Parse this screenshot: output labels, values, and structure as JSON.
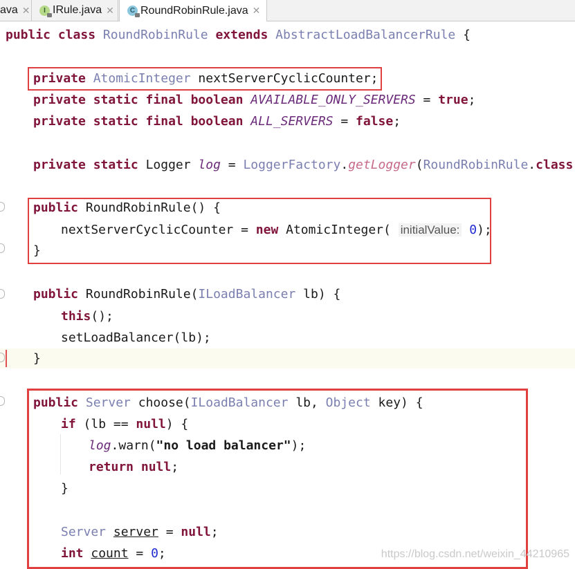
{
  "tabs": [
    {
      "label": "ava",
      "close": "✕",
      "icon": ""
    },
    {
      "label": "IRule.java",
      "close": "✕",
      "icon": "interface-icon",
      "badge": "I"
    },
    {
      "label": "RoundRobinRule.java",
      "close": "✕",
      "icon": "class-icon",
      "badge": "C",
      "active": true
    }
  ],
  "code": {
    "l1": {
      "kw1": "public class ",
      "cls": "RoundRobinRule",
      "kw2": " extends ",
      "base": "AbstractLoadBalancerRule",
      "rest": " {"
    },
    "l3": {
      "kw": "private ",
      "ty": "AtomicInteger",
      "rest": " nextServerCyclicCounter;"
    },
    "l4": {
      "kw": "private static final boolean ",
      "sf": "AVAILABLE_ONLY_SERVERS",
      "eq": " = ",
      "val": "true",
      "end": ";"
    },
    "l5": {
      "kw": "private static final boolean ",
      "sf": "ALL_SERVERS",
      "eq": " = ",
      "val": "false",
      "end": ";"
    },
    "l7": {
      "kw": "private static ",
      "t": "Logger ",
      "sf": "log",
      "eq": " = ",
      "fac": "LoggerFactory",
      "dot": ".",
      "mi": "getLogger",
      "p": "(",
      "ty": "RoundRobinRule",
      "dot2": ".",
      "kw2": "class",
      "end": ");"
    },
    "l9": {
      "kw": "public ",
      "rest": "RoundRobinRule() {"
    },
    "l10": {
      "a": "nextServerCyclicCounter = ",
      "kw": "new ",
      "b": "AtomicInteger(",
      "hint": "initialValue:",
      "num": "0",
      "end": ");"
    },
    "l11": {
      "t": "}"
    },
    "l13": {
      "kw": "public ",
      "a": "RoundRobinRule(",
      "ty": "ILoadBalancer",
      "b": " lb) {"
    },
    "l14": {
      "kw": "this",
      "end": "();"
    },
    "l15": {
      "t": "setLoadBalancer(lb);"
    },
    "l16": {
      "t": "}"
    },
    "l18": {
      "kw": "public ",
      "ty": "Server",
      "a": " choose(",
      "ty2": "ILoadBalancer",
      "b": " lb, ",
      "ty3": "Object",
      "c": " key) {"
    },
    "l19": {
      "kw": "if",
      "a": " (lb == ",
      "kw2": "null",
      "b": ") {"
    },
    "l20": {
      "sf": "log",
      "a": ".warn(",
      "str": "\"no load balancer\"",
      "end": ");"
    },
    "l21": {
      "kw": "return null",
      "end": ";"
    },
    "l22": {
      "t": "}"
    },
    "l24": {
      "ty": "Server",
      "sp": " ",
      "var": "server",
      "eq": " = ",
      "kw": "null",
      "end": ";"
    },
    "l25": {
      "kw": "int",
      "sp": " ",
      "var": "count",
      "eq": " = ",
      "num": "0",
      "end": ";"
    }
  },
  "watermark": "https://blog.csdn.net/weixin_44210965",
  "colors": {
    "highlight_box": "#e04040",
    "keyword": "#80143a",
    "type": "#7a7fb0",
    "number": "#1f2bd1"
  }
}
